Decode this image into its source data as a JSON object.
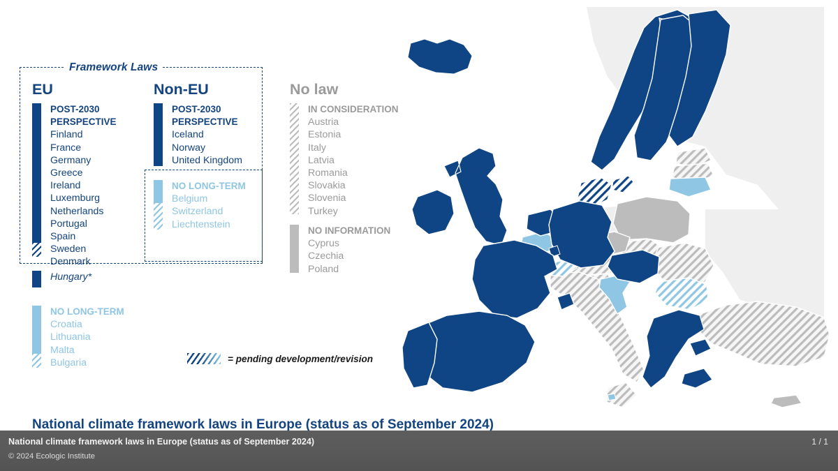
{
  "legend": {
    "framework_title": "Framework Laws",
    "columns": {
      "eu": "EU",
      "non_eu": "Non-EU",
      "no_law": "No law"
    },
    "eu_post_2030": {
      "category": "POST-2030 PERSPECTIVE",
      "countries": [
        "Finland",
        "France",
        "Germany",
        "Greece",
        "Ireland",
        "Luxemburg",
        "Netherlands",
        "Portugal",
        "Spain",
        "Sweden",
        "Denmark"
      ]
    },
    "eu_footnote": {
      "country": "Hungary*"
    },
    "eu_no_long_term": {
      "category": "NO LONG-TERM",
      "countries": [
        "Croatia",
        "Lithuania",
        "Malta",
        "Bulgaria"
      ]
    },
    "non_eu_post_2030": {
      "category": "POST-2030 PERSPECTIVE",
      "countries": [
        "Iceland",
        "Norway",
        "United Kingdom"
      ]
    },
    "non_eu_no_long_term": {
      "category": "NO LONG-TERM",
      "countries": [
        "Belgium",
        "Switzerland",
        "Liechtenstein"
      ]
    },
    "in_consideration": {
      "category": "IN CONSIDERATION",
      "countries": [
        "Austria",
        "Estonia",
        "Italy",
        "Latvia",
        "Romania",
        "Slovakia",
        "Slovenia",
        "Turkey"
      ]
    },
    "no_information": {
      "category": "NO INFORMATION",
      "countries": [
        "Cyprus",
        "Czechia",
        "Poland"
      ]
    },
    "pending_key_label": "= pending development/revision"
  },
  "slide": {
    "title": "National climate framework laws in Europe (status as of September 2024)"
  },
  "status_bar": {
    "title": "National climate framework laws in Europe (status as of September 2024)",
    "copyright": "© 2024 Ecologic Institute",
    "pages": "1 / 1"
  },
  "colors": {
    "navy": "#0f4584",
    "navy_text": "#14447f",
    "light_blue": "#8ec6e4",
    "gray": "#bcbcbc",
    "gray_text": "#9a9a9a",
    "map_background": "#efefef",
    "bar": "#595959"
  },
  "map_data": {
    "type": "choropleth",
    "region": "Europe",
    "categories": {
      "post_2030_perspective": "#0f4584",
      "post_2030_perspective_pending": "#0f4584 hatched",
      "no_long_term": "#8ec6e4",
      "no_long_term_pending": "#8ec6e4 hatched",
      "in_consideration": "#bcbcbc hatched",
      "no_information": "#bcbcbc",
      "not_listed": "#efefef"
    },
    "countries": [
      {
        "name": "Iceland",
        "category": "post_2030_perspective"
      },
      {
        "name": "Norway",
        "category": "post_2030_perspective"
      },
      {
        "name": "Sweden",
        "category": "post_2030_perspective"
      },
      {
        "name": "Finland",
        "category": "post_2030_perspective"
      },
      {
        "name": "Denmark",
        "category": "post_2030_perspective_pending"
      },
      {
        "name": "United Kingdom",
        "category": "post_2030_perspective"
      },
      {
        "name": "Ireland",
        "category": "post_2030_perspective"
      },
      {
        "name": "Netherlands",
        "category": "post_2030_perspective"
      },
      {
        "name": "Germany",
        "category": "post_2030_perspective"
      },
      {
        "name": "Luxemburg",
        "category": "post_2030_perspective"
      },
      {
        "name": "France",
        "category": "post_2030_perspective"
      },
      {
        "name": "Spain",
        "category": "post_2030_perspective"
      },
      {
        "name": "Portugal",
        "category": "post_2030_perspective"
      },
      {
        "name": "Greece",
        "category": "post_2030_perspective"
      },
      {
        "name": "Hungary",
        "category": "post_2030_perspective"
      },
      {
        "name": "Belgium",
        "category": "no_long_term"
      },
      {
        "name": "Croatia",
        "category": "no_long_term"
      },
      {
        "name": "Lithuania",
        "category": "no_long_term"
      },
      {
        "name": "Malta",
        "category": "no_long_term"
      },
      {
        "name": "Bulgaria",
        "category": "no_long_term_pending"
      },
      {
        "name": "Switzerland",
        "category": "no_long_term_pending"
      },
      {
        "name": "Liechtenstein",
        "category": "no_long_term_pending"
      },
      {
        "name": "Austria",
        "category": "in_consideration"
      },
      {
        "name": "Estonia",
        "category": "in_consideration"
      },
      {
        "name": "Italy",
        "category": "in_consideration"
      },
      {
        "name": "Latvia",
        "category": "in_consideration"
      },
      {
        "name": "Romania",
        "category": "in_consideration"
      },
      {
        "name": "Slovakia",
        "category": "in_consideration"
      },
      {
        "name": "Slovenia",
        "category": "in_consideration"
      },
      {
        "name": "Turkey",
        "category": "in_consideration"
      },
      {
        "name": "Cyprus",
        "category": "no_information"
      },
      {
        "name": "Czechia",
        "category": "no_information"
      },
      {
        "name": "Poland",
        "category": "no_information"
      }
    ]
  }
}
